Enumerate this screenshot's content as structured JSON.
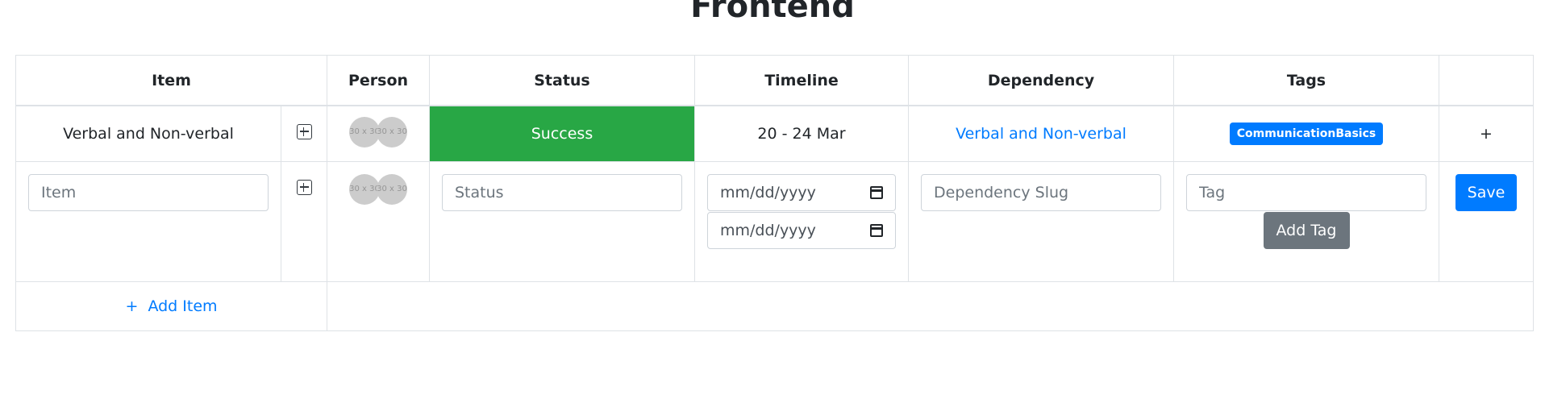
{
  "page": {
    "title": "Frontend"
  },
  "table": {
    "headers": [
      "Item",
      "Person",
      "Status",
      "Timeline",
      "Dependency",
      "Tags",
      ""
    ],
    "row": {
      "item": "Verbal and Non-verbal",
      "avatar_text": "30 x 30",
      "status": "Success",
      "timeline": "20 - 24 Mar",
      "dependency": "Verbal and Non-verbal",
      "tag": "CommunicationBasics",
      "add_label": "+"
    },
    "form": {
      "item_placeholder": "Item",
      "avatar_text": "30 x 30",
      "status_placeholder": "Status",
      "date_start": "mm/dd/yyyy",
      "date_end": "mm/dd/yyyy",
      "dependency_placeholder": "Dependency Slug",
      "tag_placeholder": "Tag",
      "add_tag_label": "Add Tag",
      "save_label": "Save"
    },
    "add_item_label": "+  Add Item"
  },
  "colors": {
    "success": "#28a745",
    "primary": "#007bff",
    "secondary": "#6c757d"
  },
  "icons": {
    "expand": "plus-square-icon",
    "calendar": "calendar-icon"
  }
}
